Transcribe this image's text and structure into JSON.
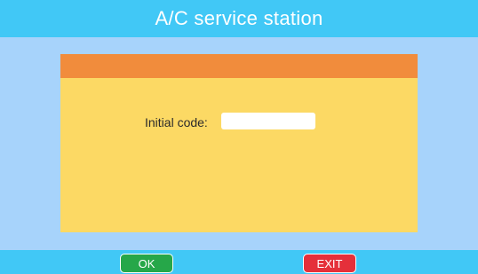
{
  "header": {
    "title": "A/C service station"
  },
  "dialog": {
    "code_label": "Initial code:",
    "code_value": ""
  },
  "footer": {
    "ok_label": "OK",
    "exit_label": "EXIT"
  },
  "colors": {
    "background": "#a7d3fb",
    "bar": "#41c8f6",
    "dialog_body": "#fcd964",
    "dialog_header": "#f18c3c",
    "ok_button": "#26a749",
    "exit_button": "#e5303a"
  }
}
